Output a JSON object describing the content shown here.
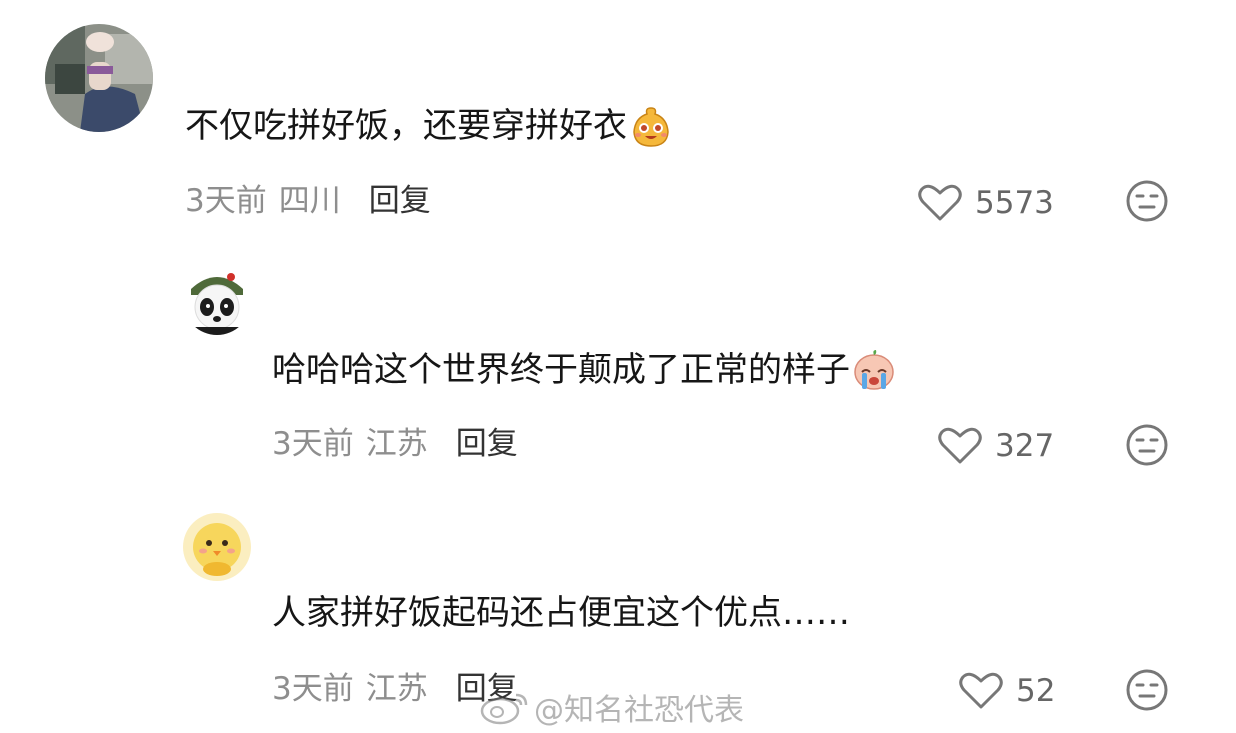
{
  "comments": [
    {
      "text": "不仅吃拼好饭，还要穿拼好衣",
      "emoji": "happy-face-sticker",
      "time": "3天前",
      "location": "四川",
      "reply_label": "回复",
      "likes": "5573"
    },
    {
      "text": "哈哈哈这个世界终于颠成了正常的样子",
      "emoji": "crying-baby-sticker",
      "time": "3天前",
      "location": "江苏",
      "reply_label": "回复",
      "likes": "327"
    },
    {
      "text": "人家拼好饭起码还占便宜这个优点……",
      "time": "3天前",
      "location": "江苏",
      "reply_label": "回复",
      "likes": "52"
    }
  ],
  "watermark": "@知名社恐代表",
  "colors": {
    "text": "#161616",
    "meta": "#8e8e8e",
    "reply": "#333333",
    "icon": "#777777"
  }
}
